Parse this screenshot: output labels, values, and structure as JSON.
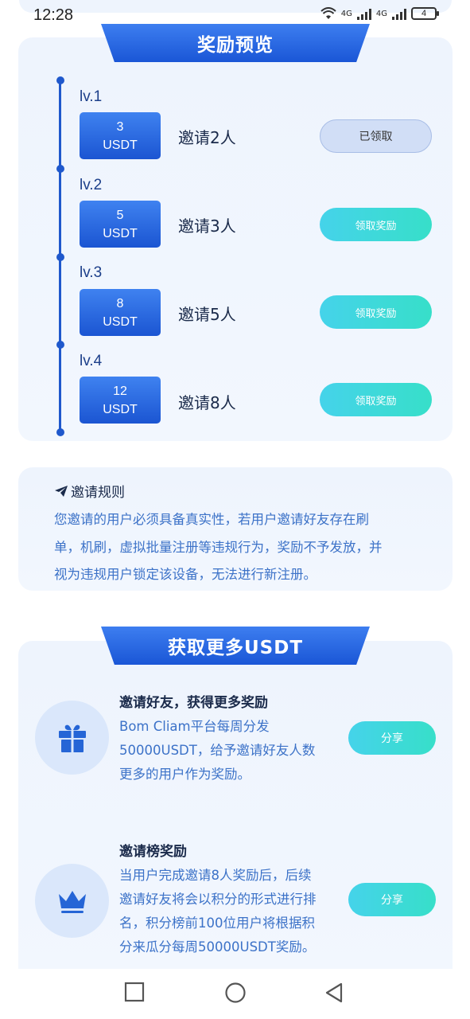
{
  "status_bar": {
    "time": "12:28",
    "net1": "4G",
    "net2": "4G",
    "battery": "4"
  },
  "rewards": {
    "title": "奖励预览",
    "levels": [
      {
        "level": "lv.1",
        "amount": "3",
        "unit": "USDT",
        "invite": "邀请2人",
        "button": "已领取",
        "claimed": true
      },
      {
        "level": "lv.2",
        "amount": "5",
        "unit": "USDT",
        "invite": "邀请3人",
        "button": "领取奖励",
        "claimed": false
      },
      {
        "level": "lv.3",
        "amount": "8",
        "unit": "USDT",
        "invite": "邀请5人",
        "button": "领取奖励",
        "claimed": false
      },
      {
        "level": "lv.4",
        "amount": "12",
        "unit": "USDT",
        "invite": "邀请8人",
        "button": "领取奖励",
        "claimed": false
      }
    ]
  },
  "rules": {
    "title": "邀请规则",
    "line1": "您邀请的用户必须具备真实性，若用户邀请好友存在刷",
    "line2": "单，机刷，虚拟批量注册等违规行为，奖励不予发放，并",
    "line3": "视为违规用户锁定该设备，无法进行新注册。"
  },
  "more": {
    "title": "获取更多USDT",
    "features": [
      {
        "title": "邀请好友，获得更多奖励",
        "lines": [
          "Bom Cliam平台每周分发",
          "50000USDT，给予邀请好友人数",
          "更多的用户作为奖励。"
        ],
        "button": "分享",
        "icon": "gift-icon"
      },
      {
        "title": "邀请榜奖励",
        "lines": [
          "当用户完成邀请8人奖励后，后续",
          "邀请好友将会以积分的形式进行排",
          "名，积分榜前100位用户将根据积",
          "分来瓜分每周50000USDT奖励。"
        ],
        "button": "分享",
        "icon": "crown-icon"
      }
    ]
  },
  "colors": {
    "primary": "#1f58cc",
    "accent_gradient_start": "#45d3ea",
    "accent_gradient_end": "#37dfc9",
    "card_bg": "#eef4fd",
    "desc_text": "#3c72c8"
  }
}
